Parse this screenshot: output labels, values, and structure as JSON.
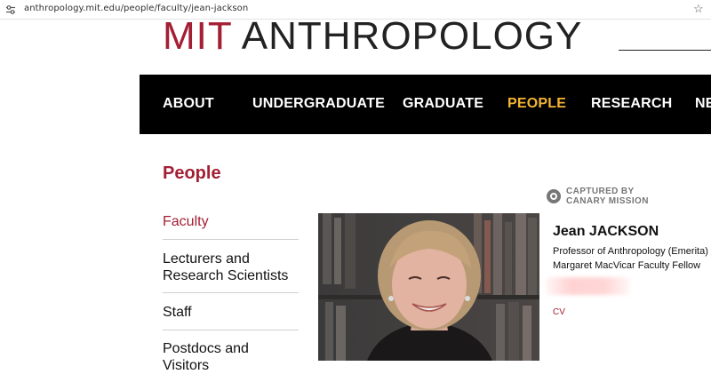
{
  "browser": {
    "url": "anthropology.mit.edu/people/faculty/jean-jackson",
    "site_info_icon": "tune-icon",
    "bookmark_icon": "star-icon"
  },
  "header": {
    "logo_mit": "MIT",
    "logo_anthropology": "ANTHROPOLOGY"
  },
  "nav": {
    "items": [
      {
        "label": "ABOUT",
        "active": false
      },
      {
        "label": "UNDERGRADUATE",
        "active": false
      },
      {
        "label": "GRADUATE",
        "active": false
      },
      {
        "label": "PEOPLE",
        "active": true
      },
      {
        "label": "RESEARCH",
        "active": false
      },
      {
        "label": "NE",
        "active": false
      }
    ],
    "active_color": "#f5b433"
  },
  "sidebar": {
    "title": "People",
    "items": [
      {
        "label": "Faculty",
        "active": true
      },
      {
        "label": "Lecturers and Research Scientists",
        "active": false
      },
      {
        "label": "Staff",
        "active": false
      },
      {
        "label": "Postdocs and Visitors",
        "active": false
      }
    ]
  },
  "badge": {
    "line1": "CAPTURED BY",
    "line2": "CANARY MISSION",
    "icon": "canary-mission-icon"
  },
  "person": {
    "name": "Jean JACKSON",
    "title1": "Professor of Anthropology (Emerita)",
    "title2": "Margaret MacVicar Faculty Fellow",
    "cv_label": "CV"
  },
  "colors": {
    "brand_red": "#a31f34",
    "nav_bg": "#000000"
  }
}
